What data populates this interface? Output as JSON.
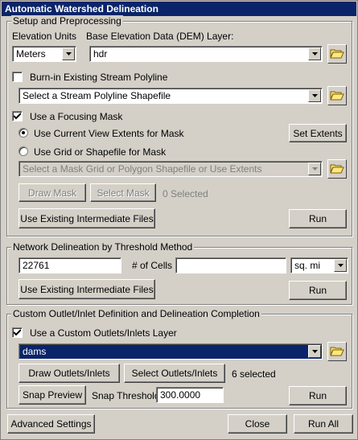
{
  "window": {
    "title": "Automatic Watershed Delineation"
  },
  "setup": {
    "group_label": "Setup and Preprocessing",
    "elevation_units_label": "Elevation Units",
    "elevation_units_value": "Meters",
    "dem_label": "Base Elevation Data (DEM) Layer:",
    "dem_value": "hdr",
    "burnin_label": "Burn-in Existing Stream Polyline",
    "burnin_checked": false,
    "stream_select_value": "Select a Stream Polyline Shapefile",
    "focus_mask_label": "Use a Focusing Mask",
    "focus_mask_checked": true,
    "radio_current_view_label": "Use Current View Extents for Mask",
    "radio_grid_label": "Use Grid or Shapefile for Mask",
    "set_extents_label": "Set Extents",
    "mask_select_value": "Select a Mask Grid or Polygon Shapefile or Use Extents",
    "draw_mask_label": "Draw Mask",
    "select_mask_label": "Select Mask",
    "mask_selected_status": "0 Selected",
    "use_existing_label": "Use Existing Intermediate Files",
    "run_label": "Run"
  },
  "network": {
    "group_label": "Network Delineation by Threshold Method",
    "threshold_value": "22761",
    "cells_label": "# of Cells",
    "area_value": "",
    "area_unit_value": "sq. mi",
    "use_existing_label": "Use Existing Intermediate Files",
    "run_label": "Run"
  },
  "outlet": {
    "group_label": "Custom Outlet/Inlet Definition and Delineation Completion",
    "custom_outlets_label": "Use a Custom Outlets/Inlets Layer",
    "custom_outlets_checked": true,
    "outlets_layer_value": "dams",
    "draw_outlets_label": "Draw Outlets/Inlets",
    "select_outlets_label": "Select Outlets/Inlets",
    "outlets_selected_status": "6 selected",
    "snap_preview_label": "Snap Preview",
    "snap_threshold_label": "Snap Threshold",
    "snap_threshold_value": "300.0000",
    "run_label": "Run"
  },
  "footer": {
    "advanced_label": "Advanced Settings",
    "close_label": "Close",
    "run_all_label": "Run All"
  },
  "icons": {
    "folder": "open-folder-icon",
    "dropdown": "chevron-down-icon",
    "check": "checkmark-icon"
  },
  "colors": {
    "titlebar": "#0a246a",
    "face": "#d4d0c8",
    "selection": "#0a246a"
  }
}
